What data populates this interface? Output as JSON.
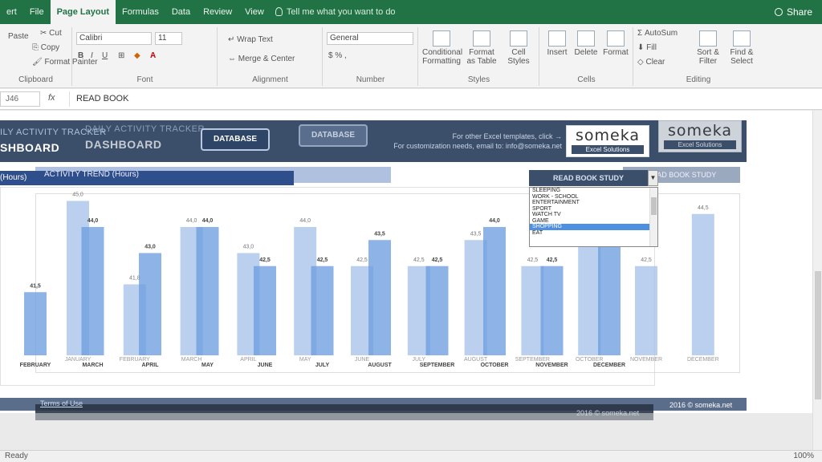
{
  "tabs": [
    "ert",
    "File",
    "Page Layout",
    "Formulas",
    "Data",
    "Review",
    "View"
  ],
  "ghost_tabs": [
    "Insert",
    "Page Layout",
    "Formulas",
    "Data",
    "Review",
    "View"
  ],
  "tell_me": "Tell me what you want to do",
  "share": "Share",
  "ribbon": {
    "font_name": "Calibri",
    "font_size": "11",
    "cut": "Cut",
    "copy": "Copy",
    "paste": "Paste",
    "format_painter": "Format Painter",
    "wrap_text": "Wrap Text",
    "merge_center": "Merge & Center",
    "number_format": "General",
    "conditional_formatting": "Conditional Formatting",
    "format_as_table": "Format as Table",
    "cell_styles": "Cell Styles",
    "insert": "Insert",
    "delete": "Delete",
    "format": "Format",
    "autosum": "AutoSum",
    "fill": "Fill",
    "clear": "Clear",
    "sort_filter": "Sort & Filter",
    "find_select": "Find & Select",
    "groups": {
      "clipboard": "Clipboard",
      "font": "Font",
      "alignment": "Alignment",
      "number": "Number",
      "styles": "Styles",
      "cells": "Cells",
      "editing": "Editing"
    }
  },
  "formula": {
    "cell_ref": "J46",
    "fx": "fx",
    "value": "READ BOOK"
  },
  "dashboard": {
    "subtitle": "ILY ACTIVITY TRACKER",
    "ghost_subtitle": "DAILY ACTIVITY TRACKER",
    "title": "SHBOARD",
    "ghost_title": "DASHBOARD",
    "database_button": "DATABASE",
    "ghost_database_button": "DATABASE",
    "promo_line1": "For other Excel templates, click →",
    "promo_line2": "For customization needs, email to: info@someka.net",
    "logo_text": "someka",
    "logo_sub": "Excel Solutions",
    "trend_label": "(Hours)",
    "trend_ghost_label": "ACTIVITY TREND (Hours)",
    "selected_activity": "READ BOOK STUDY",
    "ghost_activity": "READ BOOK STUDY",
    "activity_options": [
      "SLEEPING",
      "WORK - SCHOOL",
      "ENTERTAINMENT",
      "SPORT",
      "WATCH TV",
      "GAME",
      "SHOPPING",
      "EAT"
    ],
    "selected_option_index": 6,
    "terms": "Terms of Use",
    "copyright": "2016 © someka.net",
    "copyright_ghost": "2016 © someka.net"
  },
  "chart_data": {
    "type": "bar",
    "ylim": [
      40,
      46
    ],
    "series": [
      {
        "categories": [
          "JANUARY",
          "FEBRUARY",
          "MARCH",
          "APRIL",
          "MAY",
          "JUNE",
          "JULY",
          "AUGUST",
          "SEPTEMBER",
          "OCTOBER",
          "NOVEMBER",
          "DECEMBER"
        ],
        "values": [
          45.0,
          41.8,
          44.0,
          43.0,
          44.0,
          42.5,
          42.5,
          43.5,
          42.5,
          44.0,
          42.5,
          44.5
        ],
        "labels": [
          "45,0",
          "41,8",
          "44,0",
          "43,0",
          "44,0",
          "42,5",
          "42,5",
          "43,5",
          "42,5",
          "44,0",
          "42,5",
          "44,5"
        ]
      },
      {
        "categories": [
          "FEBRUARY",
          "MARCH",
          "APRIL",
          "MAY",
          "JUNE",
          "JULY",
          "AUGUST",
          "SEPTEMBER",
          "OCTOBER",
          "NOVEMBER",
          "DECEMBER"
        ],
        "values": [
          41.5,
          44.0,
          43.0,
          44.0,
          42.5,
          42.5,
          43.5,
          42.5,
          44.0,
          42.5,
          44.0
        ],
        "labels": [
          "41,5",
          "44,0",
          "43,0",
          "44,0",
          "42,5",
          "42,5",
          "43,5",
          "42,5",
          "44,0",
          "42,5",
          "44,0"
        ]
      }
    ]
  },
  "status": {
    "ready": "Ready",
    "zoom": "100%"
  }
}
